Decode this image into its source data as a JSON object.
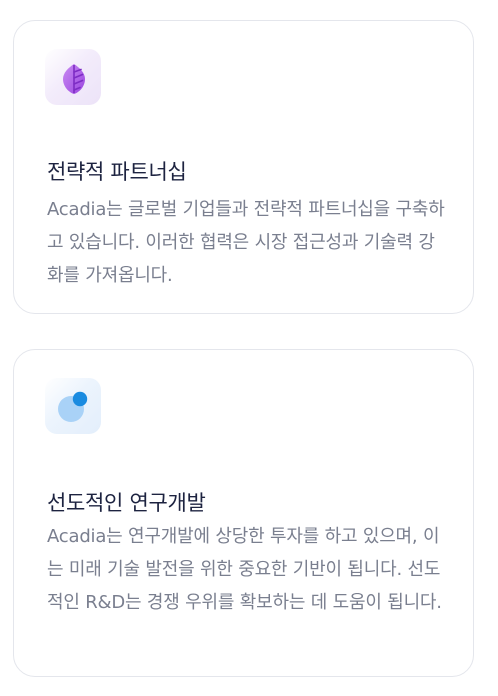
{
  "cards": [
    {
      "icon": "leaf-icon",
      "accent": "#a24fe3",
      "title": "전략적 파트너십",
      "description": "Acadia는 글로벌 기업들과 전략적 파트너십을 구축하고 있습니다. 이러한 협력은 시장 접근성과 기술력 강화를 가져옵니다."
    },
    {
      "icon": "pie-chart-icon",
      "accent": "#1a8be0",
      "title": "선도적인 연구개발",
      "description": "Acadia는 연구개발에 상당한 투자를 하고 있으며, 이는 미래 기술 발전을 위한 중요한 기반이 됩니다. 선도적인 R&D는 경쟁 우위를 확보하는 데 도움이 됩니다."
    }
  ]
}
